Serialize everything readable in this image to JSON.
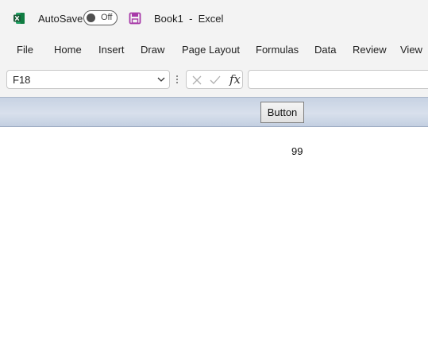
{
  "titlebar": {
    "autosave_label": "AutoSave",
    "autosave_state": "Off",
    "document_title": "Book1  -  Excel",
    "icons": [
      "excel-logo-icon",
      "save-icon"
    ],
    "colors": {
      "excel_green": "#1d6f42",
      "save_purple": "#a73aa8"
    }
  },
  "ribbon": {
    "tabs": [
      "File",
      "Home",
      "Insert",
      "Draw",
      "Page Layout",
      "Formulas",
      "Data",
      "Review",
      "View"
    ]
  },
  "formula_bar": {
    "name_box": "F18",
    "formula_value": "",
    "icons": [
      "chevron-down-icon",
      "more-options-icon",
      "cancel-icon",
      "enter-icon",
      "insert-function-icon"
    ],
    "fx_label": "fx"
  },
  "sheet": {
    "button_label": "Button",
    "cell_value": "99"
  }
}
